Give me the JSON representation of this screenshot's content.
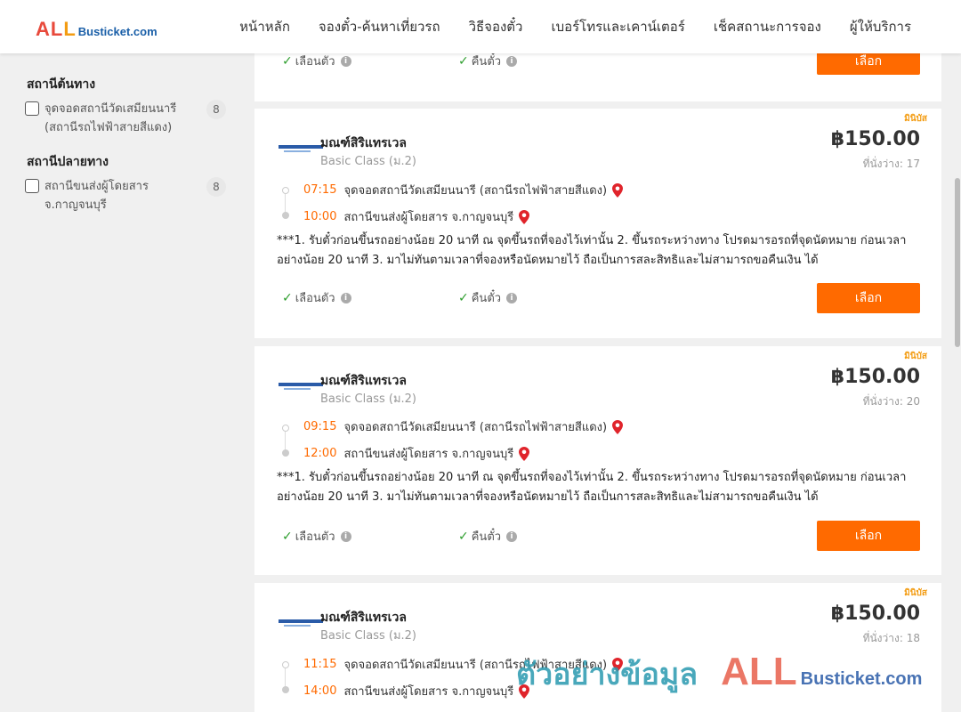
{
  "header": {
    "logo_all": "ALL",
    "logo_rest": "Busticket.com",
    "nav": [
      "หน้าหลัก",
      "จองตั๋ว-ค้นหาเที่ยวรถ",
      "วิธีจองตั๋ว",
      "เบอร์โทรและเคาน์เตอร์",
      "เช็คสถานะการจอง",
      "ผู้ให้บริการ"
    ]
  },
  "sidebar": {
    "origin_title": "สถานีต้นทาง",
    "origin_item": "จุดจอดสถานีวัดเสมียนนารี (สถานีรถไฟฟ้าสายสีแดง)",
    "origin_count": "8",
    "dest_title": "สถานีปลายทาง",
    "dest_item": "สถานีขนส่งผู้โดยสาร จ.กาญจนบุรี",
    "dest_count": "8"
  },
  "top_card": {
    "feature_seat": "เลือนตัว",
    "feature_refund": "คืนตั๋ว",
    "select": "เลือก"
  },
  "trips": [
    {
      "badge": "มินิบัส",
      "operator": "มณฑ์สิริแทรเวล",
      "class": "Basic Class (ม.2)",
      "price": "฿150.00",
      "seats": "ที่นั่งว่าง: 17",
      "depart_time": "07:15",
      "depart_stop": "จุดจอดสถานีวัดเสมียนนารี (สถานีรถไฟฟ้าสายสีแดง)",
      "arrive_time": "10:00",
      "arrive_stop": "สถานีขนส่งผู้โดยสาร จ.กาญจนบุรี",
      "note": "***1. รับตั๋วก่อนขึ้นรถอย่างน้อย 20 นาที ณ จุดขึ้นรถที่จองไว้เท่านั้น 2. ขึ้นรถระหว่างทาง โปรดมารอรถที่จุดนัดหมาย ก่อนเวลาอย่างน้อย 20 นาที 3. มาไม่ทันตามเวลาที่จองหรือนัดหมายไว้ ถือเป็นการสละสิทธิและไม่สามารถขอคืนเงิน ได้",
      "feature_seat": "เลือนตัว",
      "feature_refund": "คืนตั๋ว",
      "select": "เลือก"
    },
    {
      "badge": "มินิบัส",
      "operator": "มณฑ์สิริแทรเวล",
      "class": "Basic Class (ม.2)",
      "price": "฿150.00",
      "seats": "ที่นั่งว่าง: 20",
      "depart_time": "09:15",
      "depart_stop": "จุดจอดสถานีวัดเสมียนนารี (สถานีรถไฟฟ้าสายสีแดง)",
      "arrive_time": "12:00",
      "arrive_stop": "สถานีขนส่งผู้โดยสาร จ.กาญจนบุรี",
      "note": "***1. รับตั๋วก่อนขึ้นรถอย่างน้อย 20 นาที ณ จุดขึ้นรถที่จองไว้เท่านั้น 2. ขึ้นรถระหว่างทาง โปรดมารอรถที่จุดนัดหมาย ก่อนเวลาอย่างน้อย 20 นาที 3. มาไม่ทันตามเวลาที่จองหรือนัดหมายไว้ ถือเป็นการสละสิทธิและไม่สามารถขอคืนเงิน ได้",
      "feature_seat": "เลือนตัว",
      "feature_refund": "คืนตั๋ว",
      "select": "เลือก"
    },
    {
      "badge": "มินิบัส",
      "operator": "มณฑ์สิริแทรเวล",
      "class": "Basic Class (ม.2)",
      "price": "฿150.00",
      "seats": "ที่นั่งว่าง: 18",
      "depart_time": "11:15",
      "depart_stop": "จุดจอดสถานีวัดเสมียนนารี (สถานีรถไฟฟ้าสายสีแดง)",
      "arrive_time": "14:00",
      "arrive_stop": "สถานีขนส่งผู้โดยสาร จ.กาญจนบุรี"
    }
  ],
  "watermark": {
    "text": "ตัวอย่างข้อมูล",
    "all": "ALL",
    "rest": "Busticket.com"
  },
  "colors": {
    "accent": "#ff6a00",
    "badge": "#f39c12",
    "check": "#2e9e2e",
    "pin": "#e0242b"
  }
}
